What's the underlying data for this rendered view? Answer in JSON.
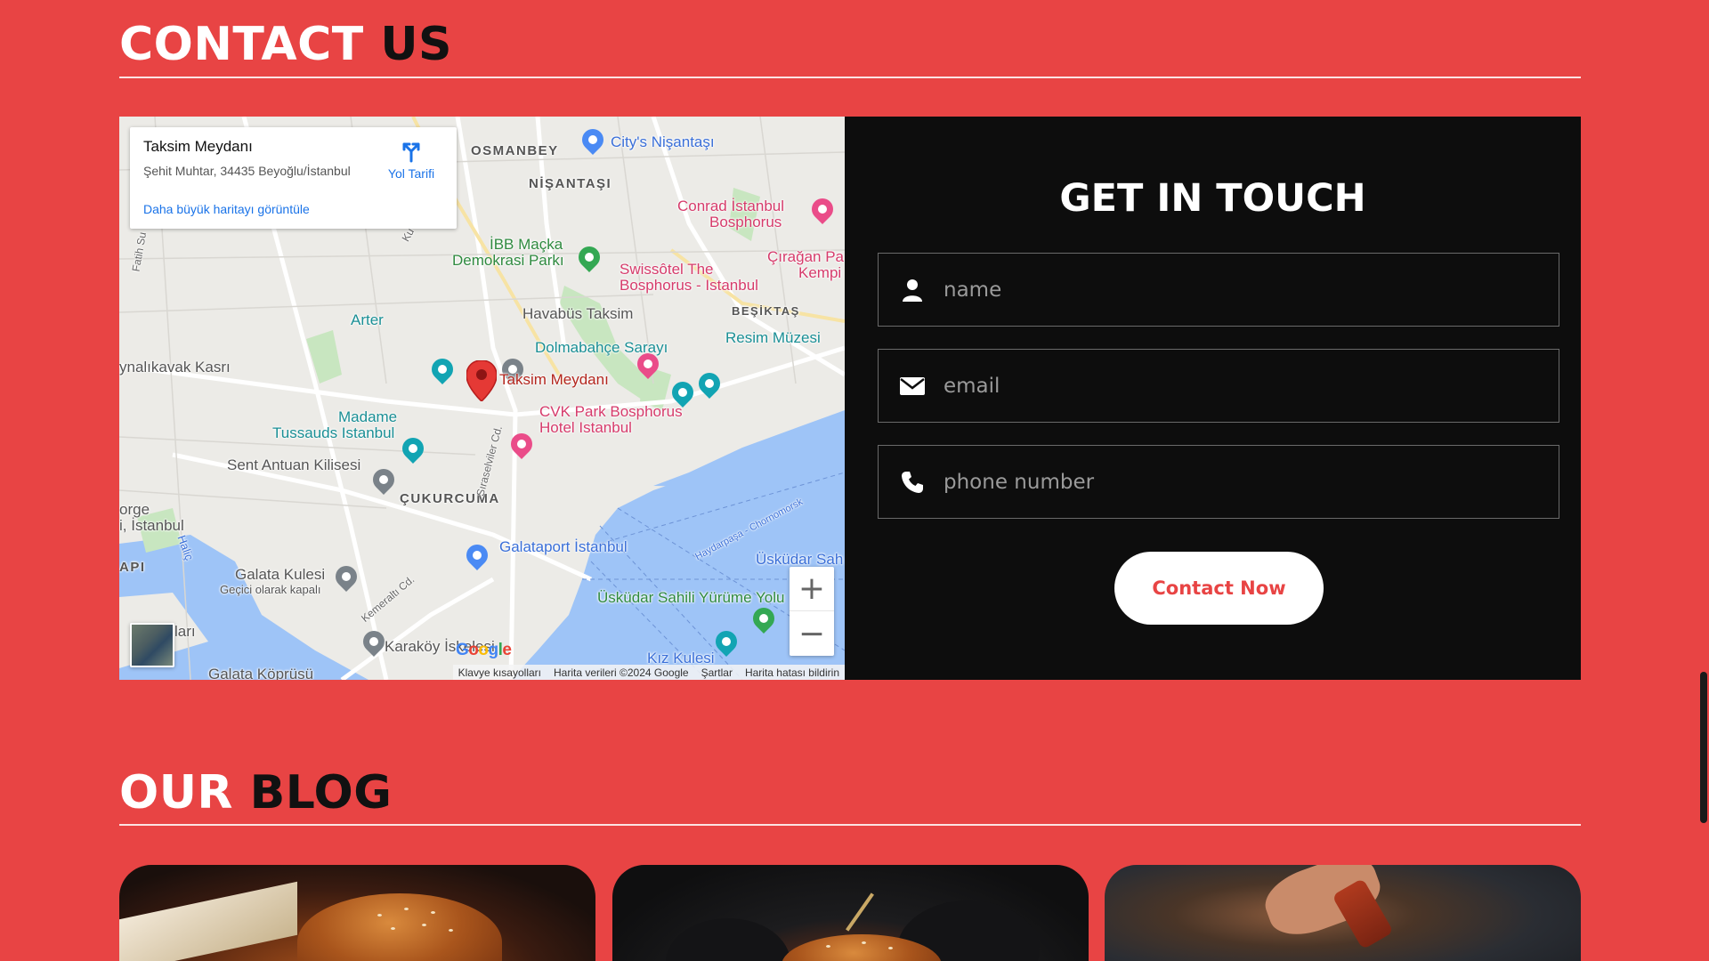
{
  "contact_section": {
    "title_part1": "CONTACT",
    "title_part2": "US"
  },
  "map": {
    "infocard": {
      "place_name": "Taksim Meydanı",
      "address": "Şehit Muhtar, 34435 Beyoğlu/İstanbul",
      "directions_label": "Yol Tarifi",
      "larger_map_link": "Daha büyük haritayı görüntüle"
    },
    "labels": {
      "osmanbey": "OSMANBEY",
      "citys": "City's Nişantaşı",
      "nisantasi": "NİŞANTAŞI",
      "conrad": "Conrad İstanbul",
      "conrad2": "Bosphorus",
      "macka": "İBB Maçka",
      "macka2": "Demokrasi Parkı",
      "ciragan": "Çırağan Pa",
      "ciragan2": "Kempi",
      "swissotel": "Swissôtel The",
      "swissotel2": "Bosphorus - Istanbul",
      "arter": "Arter",
      "havabus": "Havabüs Taksim",
      "besiktas": "BEŞİKTAŞ",
      "dolmabahce": "Dolmabahçe Sarayı",
      "resim": "Resim Müzesi",
      "aynalikavak": "ynalıkavak Kasrı",
      "taksim": "Taksim Meydanı",
      "cvk": "CVK Park Bosphorus",
      "cvk2": "Hotel Istanbul",
      "madame": "Madame",
      "madame2": "Tussauds Istanbul",
      "antuan": "Sent Antuan Kilisesi",
      "cukurcuma": "ÇUKURCUMA",
      "orge": "orge",
      "istanbul": "i, İstanbul",
      "api": "API",
      "halic": "Haliç",
      "galataport": "Galataport İstanbul",
      "haydarpasa": "Haydarpaşa - Chornomorsk",
      "uskudar_sah": "Üsküdar Sah",
      "galata_kulesi": "Galata Kulesi",
      "gecici": "Geçici olarak kapalı",
      "uskudar_yol": "Üsküdar Sahili Yürüme Yolu",
      "ari": "ları",
      "karakoy": "Karaköy İskelesi",
      "kizkulesi": "Kız Kulesi",
      "galata_koprusu": "Galata Köprüsü",
      "siraselviler": "Sıraselviler Cd.",
      "kemeralti": "Kemeraltı Cd.",
      "fatih": "Fatih Su",
      "ku": "Ku"
    },
    "zoom_in": "+",
    "zoom_out": "−",
    "google_logo": "Google",
    "attribution": {
      "keyboard": "Klavye kısayolları",
      "data": "Harita verileri ©2024 Google",
      "terms": "Şartlar",
      "report": "Harita hatası bildirin"
    }
  },
  "contact_form": {
    "title": "GET IN TOUCH",
    "name_placeholder": "name",
    "email_placeholder": "email",
    "phone_placeholder": "phone number",
    "submit_label": "Contact Now",
    "icons": [
      "user-icon",
      "envelope-icon",
      "phone-icon"
    ]
  },
  "blog_section": {
    "title_part1": "OUR",
    "title_part2": "BLOG"
  },
  "colors": {
    "page_bg": "#e84444",
    "panel_bg": "#0d0d0d",
    "accent": "#e84444",
    "water": "#9ec4f7",
    "land": "#ecebe7"
  }
}
